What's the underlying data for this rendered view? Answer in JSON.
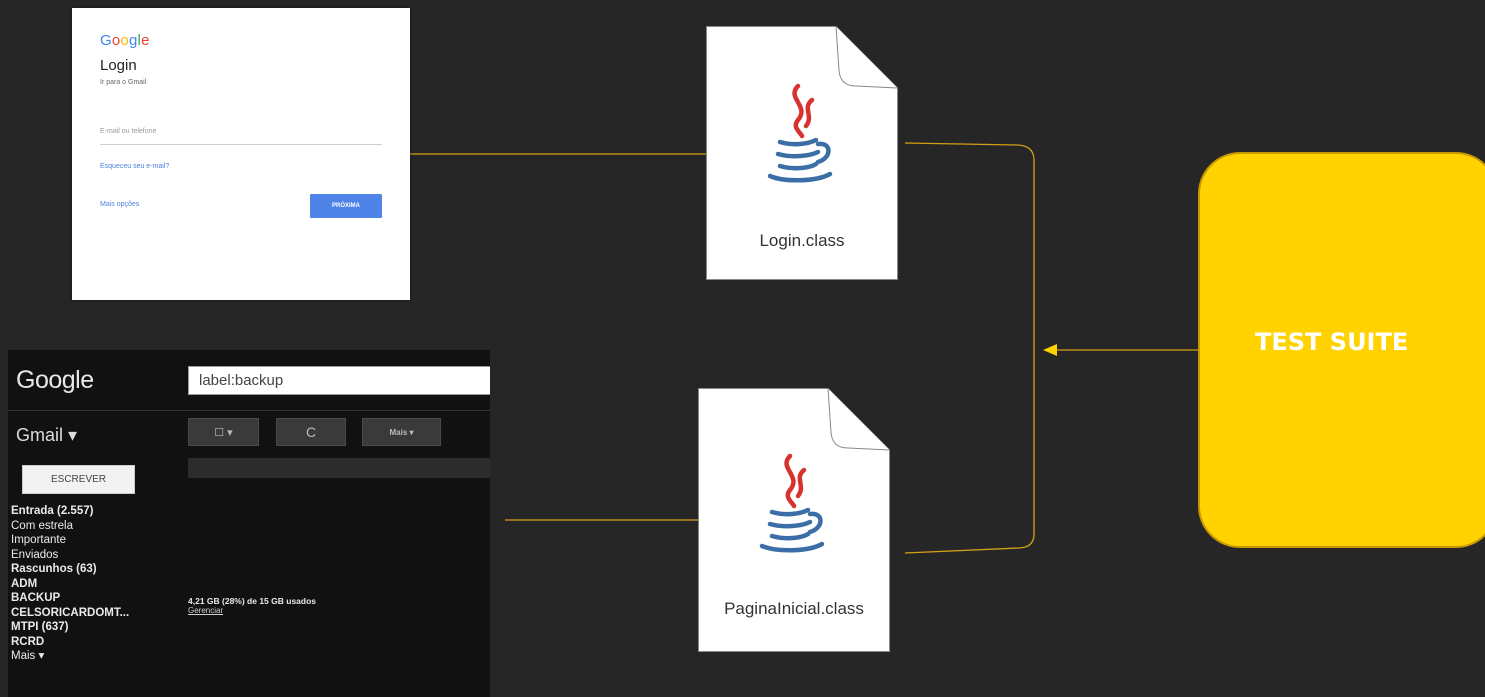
{
  "login_screen": {
    "logo": [
      "G",
      "o",
      "o",
      "g",
      "l",
      "e"
    ],
    "title": "Login",
    "subtitle": "Ir para o Gmail",
    "email_placeholder": "E-mail ou telefone",
    "forgot_link": "Esqueceu seu e-mail?",
    "more_options": "Mais opções",
    "next_button": "PRÓXIMA"
  },
  "gmail_screen": {
    "logo": "Google",
    "search_value": "label:backup",
    "gmail_menu": "Gmail ▾",
    "select_button": "☐ ▾",
    "refresh_icon": "C",
    "more_button": "Mais ▾",
    "compose_button": "ESCREVER",
    "folders": [
      {
        "label": "Entrada (2.557)",
        "bold": true
      },
      {
        "label": "Com estrela",
        "bold": false
      },
      {
        "label": "Importante",
        "bold": false
      },
      {
        "label": "Enviados",
        "bold": false
      },
      {
        "label": "Rascunhos (63)",
        "bold": true
      },
      {
        "label": "ADM",
        "bold": true
      },
      {
        "label": "BACKUP",
        "bold": true
      },
      {
        "label": "CELSORICARDOMT...",
        "bold": true
      },
      {
        "label": "MTPI (637)",
        "bold": true
      },
      {
        "label": "RCRD",
        "bold": true
      },
      {
        "label": "Mais ▾",
        "bold": false
      }
    ],
    "storage_text": "4,21 GB (28%) de 15 GB usados",
    "manage_link": "Gerenciar"
  },
  "files": {
    "login_file": "Login.class",
    "pagina_file": "PaginaInicial.class",
    "icon": "java-icon"
  },
  "test_suite": {
    "label": "TEST SUITE"
  },
  "colors": {
    "background": "#262626",
    "connector": "#d4a017",
    "test_suite_fill": "#ffd200"
  }
}
